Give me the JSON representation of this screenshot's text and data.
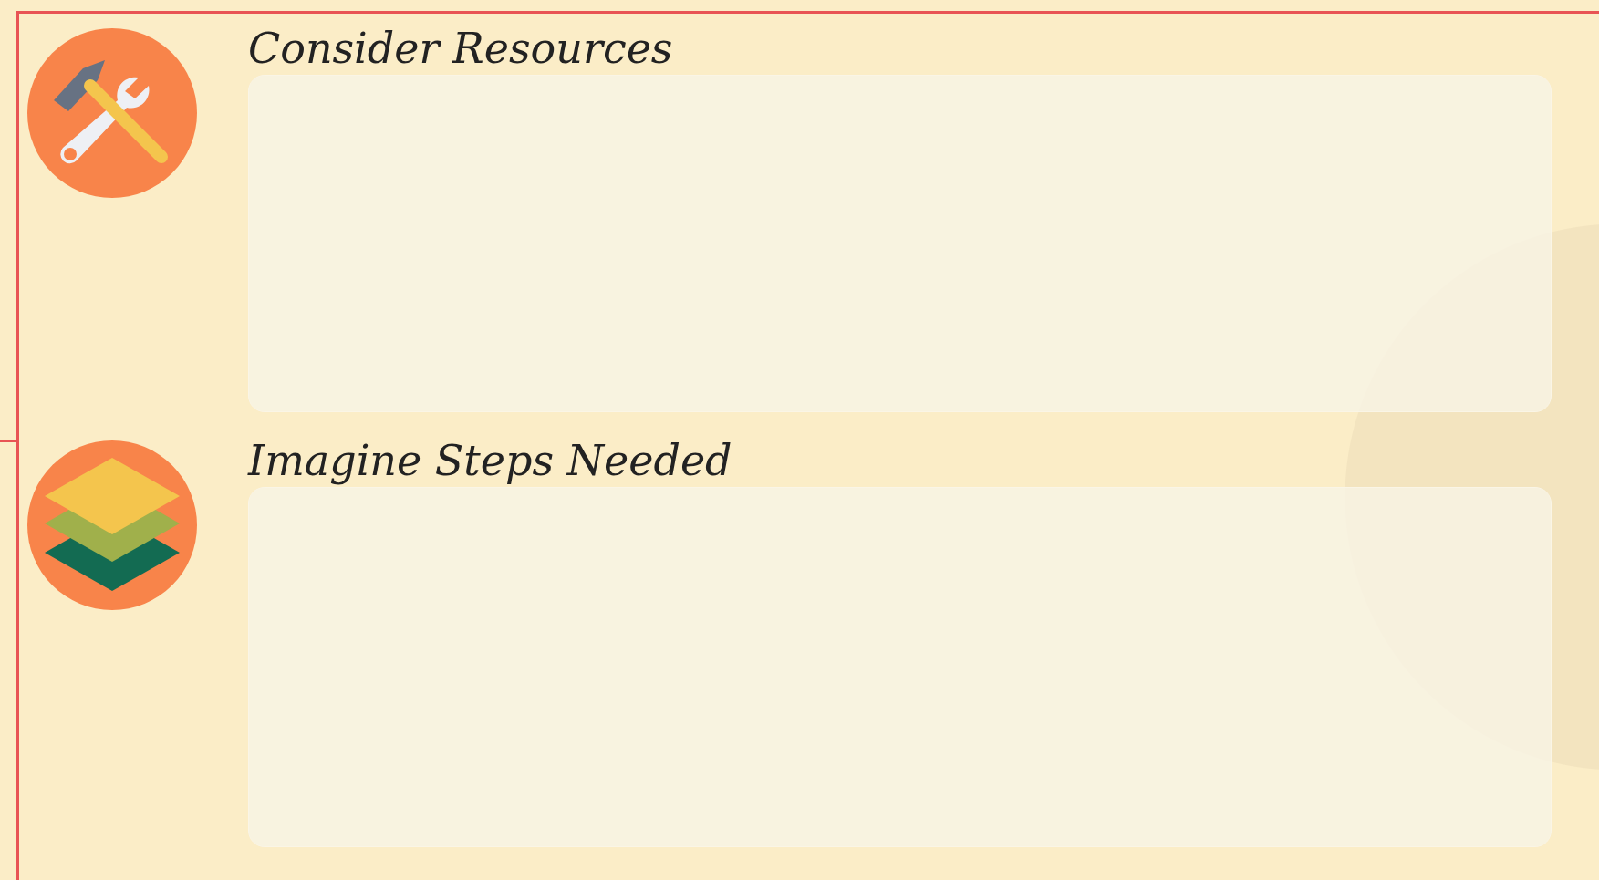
{
  "sections": [
    {
      "title": "Consider Resources",
      "icon": {
        "kind": "tools"
      }
    },
    {
      "title": "Imagine Steps Needed",
      "icon": {
        "kind": "layers"
      }
    }
  ]
}
